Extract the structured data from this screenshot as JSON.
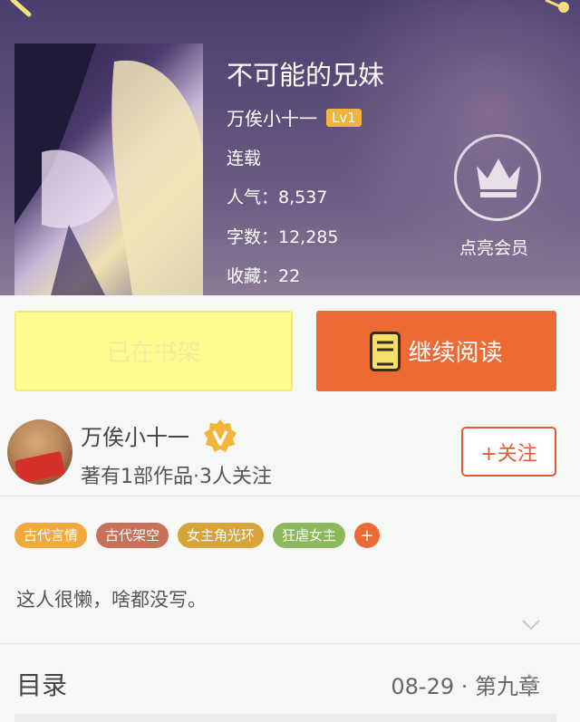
{
  "book": {
    "title": "不可能的兄妹",
    "author": "万俟小十一",
    "level": "Lv1",
    "status": "连载",
    "popularity": "人气：8,537",
    "word_count": "字数：12,285",
    "favorites": "收藏：22"
  },
  "vip": {
    "label": "点亮会员"
  },
  "actions": {
    "shelf_label": "已在书架",
    "read_label": "继续阅读"
  },
  "author_card": {
    "name": "万俟小十一",
    "summary": "著有1部作品·3人关注",
    "follow_label": "+关注"
  },
  "tags": [
    {
      "label": "古代言情",
      "color": "#f2a93b"
    },
    {
      "label": "古代架空",
      "color": "#c8705a"
    },
    {
      "label": "女主角光环",
      "color": "#d6a43a"
    },
    {
      "label": "狂虐女主",
      "color": "#8ab85a"
    }
  ],
  "tag_add": "+",
  "intro": "这人很懒，啥都没写。",
  "toc": {
    "title": "目录",
    "latest": "08-29 · 第九章"
  },
  "colors": {
    "accent": "#ed6a35",
    "shelf_bg": "#fffb8f",
    "header_bg": "#5a4d78"
  }
}
